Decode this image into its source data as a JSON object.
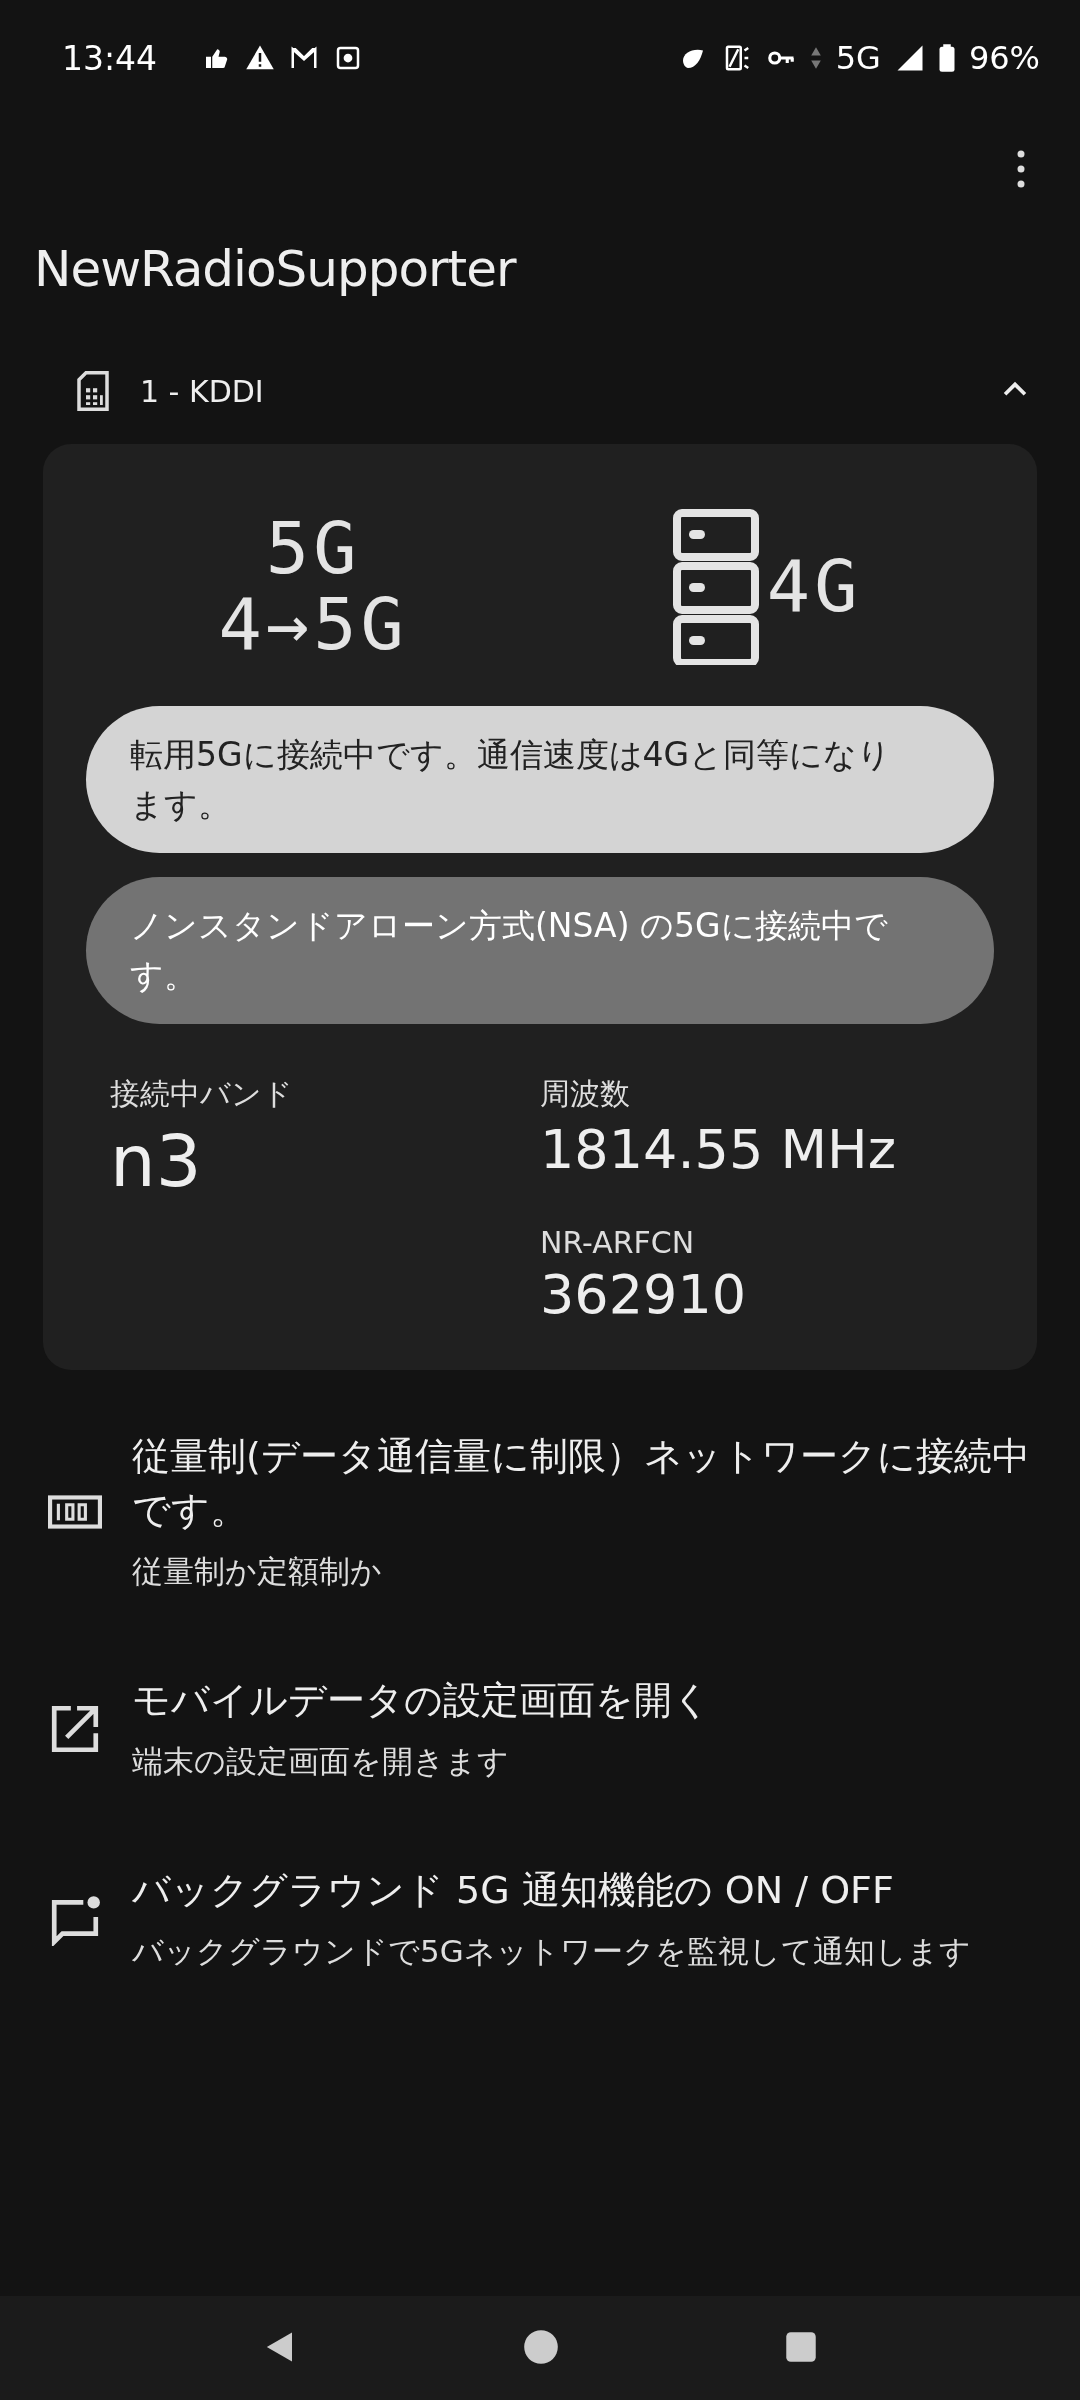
{
  "status_bar": {
    "time": "13:44",
    "network": "5G",
    "battery": "96%"
  },
  "app_bar": {
    "title": "NewRadioSupporter"
  },
  "sim": {
    "label": "1 - KDDI",
    "expanded": true
  },
  "card": {
    "left_glyphs": [
      "5G",
      "4→5G"
    ],
    "right_glyph": "4G",
    "messages": [
      {
        "kind": "primary",
        "text": "転用5Gに接続中です。通信速度は4Gと同等になります。"
      },
      {
        "kind": "secondary",
        "text": "ノンスタンドアローン方式(NSA) の5Gに接続中です。"
      }
    ],
    "band": {
      "label": "接続中バンド",
      "value": "n3"
    },
    "frequency": {
      "label": "周波数",
      "value": "1814.55 MHz"
    },
    "arfcn": {
      "label": "NR-ARFCN",
      "value": "362910"
    }
  },
  "items": [
    {
      "kind": "metered",
      "title": "従量制(データ通信量に制限）ネットワークに接続中です。",
      "subtitle": "従量制か定額制か"
    },
    {
      "kind": "open",
      "title": "モバイルデータの設定画面を開く",
      "subtitle": "端末の設定画面を開きます"
    },
    {
      "kind": "notify",
      "title": "バックグラウンド 5G 通知機能の ON / OFF",
      "subtitle": "バックグラウンドで5Gネットワークを監視して通知します"
    }
  ]
}
